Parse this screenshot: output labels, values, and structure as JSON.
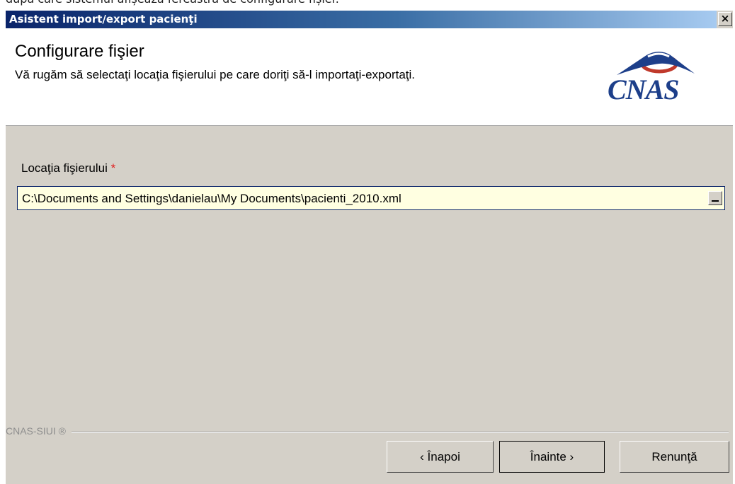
{
  "doc": {
    "fragment_text": "după care sistemul afișează fereastra de configurare fișier."
  },
  "window": {
    "title": "Asistent import/export pacienţi",
    "close_glyph": "×"
  },
  "header": {
    "title": "Configurare fişier",
    "subtitle": "Vă rugăm să selectaţi locaţia fişierului pe care doriţi să-l importaţi-exportaţi.",
    "logo_text": "CNAS",
    "logo_icon": "cnas-logo-icon"
  },
  "form": {
    "label": "Locaţia fişierului",
    "required_mark": "*",
    "path_value": "C:\\Documents and Settings\\danielau\\My Documents\\pacienti_2010.xml",
    "browse_icon": "browse-icon"
  },
  "footer": {
    "brand": "CNAS-SIUI ®",
    "back_label": "‹ Înapoi",
    "next_label": "Înainte ›",
    "cancel_label": "Renunţă"
  },
  "colors": {
    "title_gradient_start": "#0a246a",
    "title_gradient_end": "#a6caf0",
    "dialog_bg": "#d4d0c8",
    "field_bg": "#ffffe1",
    "required": "#e02020",
    "logo_blue": "#1d3f8a",
    "logo_red": "#c0392b"
  }
}
